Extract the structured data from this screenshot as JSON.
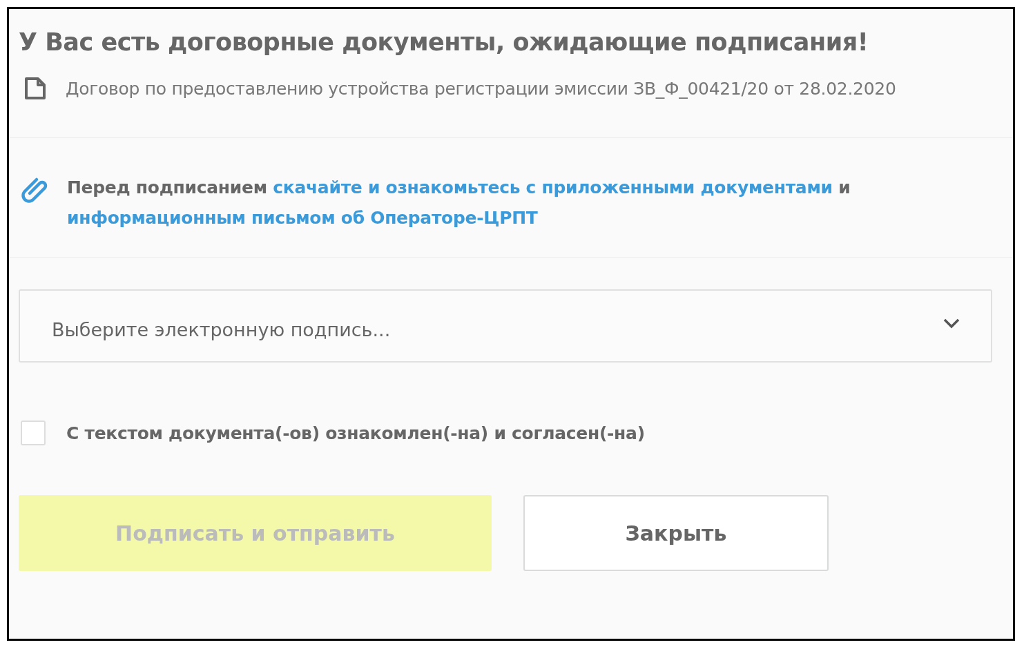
{
  "title": "У Вас есть договорные документы, ожидающие подписания!",
  "documents": [
    {
      "name": "Договор по предоставлению устройства регистрации эмиссии ЗВ_Ф_00421/20 от 28.02.2020"
    }
  ],
  "notice": {
    "parts": [
      {
        "kind": "text",
        "text": "Перед подписанием "
      },
      {
        "kind": "link",
        "text": "скачайте и ознакомьтесь с приложенными документами"
      },
      {
        "kind": "text",
        "text": " и "
      },
      {
        "kind": "link",
        "text": "информационным письмом об Операторе-ЦРПТ"
      }
    ]
  },
  "signature_select": {
    "placeholder": "Выберите электронную подпись..."
  },
  "agreement": {
    "label": "С текстом документа(-ов) ознакомлен(-на) и согласен(-на)",
    "checked": false
  },
  "buttons": [
    {
      "label": "Подписать и отправить",
      "kind": "primary",
      "disabled": true
    },
    {
      "label": "Закрыть",
      "kind": "secondary",
      "disabled": false
    }
  ]
}
